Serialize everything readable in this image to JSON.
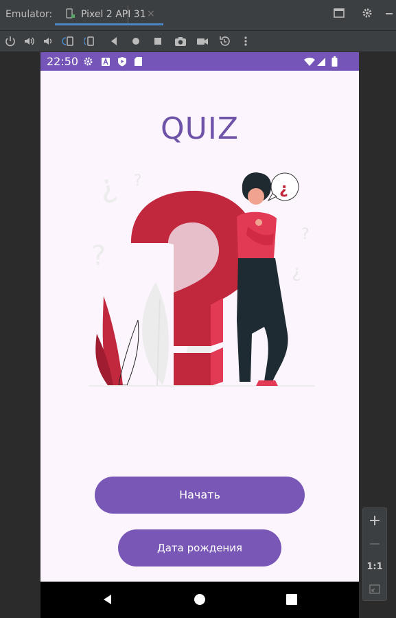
{
  "ide": {
    "emulator_label": "Emulator:",
    "device_tab": "Pixel 2 API 31",
    "tab_close": "×"
  },
  "toolbar": {
    "tools": [
      "power-icon",
      "volume-up-icon",
      "volume-down-icon",
      "rotate-left-icon",
      "rotate-right-icon",
      "back-icon",
      "home-icon",
      "overview-icon",
      "camera-icon",
      "video-icon",
      "snapshot-icon",
      "more-icon"
    ]
  },
  "phone": {
    "status_time": "22:50",
    "title": "QUIZ",
    "start_button": "Начать",
    "birthdate_button": "Дата рождения",
    "illustration_mark": "¿"
  },
  "zoom": {
    "zoom_in": "+",
    "zoom_out": "−",
    "one_to_one": "1:1"
  },
  "colors": {
    "status_bar": "#7655b8",
    "accent": "#7857b6",
    "title": "#6f53a8",
    "background": "#fcf5fd",
    "question_red": "#c2283d"
  }
}
